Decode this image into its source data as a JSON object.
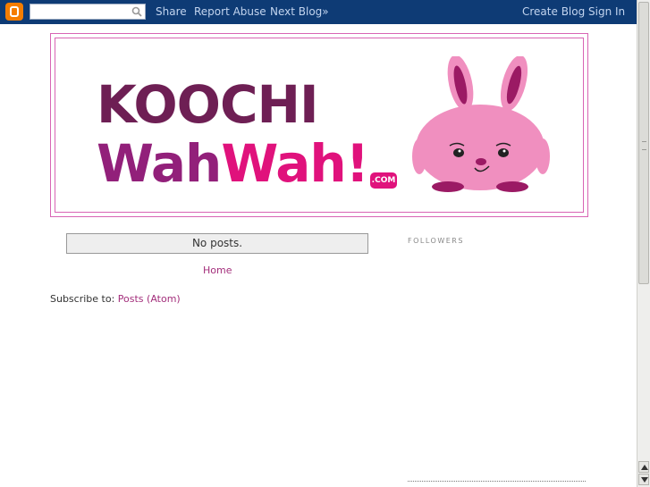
{
  "navbar": {
    "search_value": "",
    "links": {
      "share": "Share",
      "report_abuse": "Report Abuse",
      "next_blog": "Next Blog»",
      "create_blog": "Create Blog",
      "sign_in": "Sign In"
    }
  },
  "header": {
    "logo_line1": "KOOCHI",
    "logo_line2_part1": "Wah",
    "logo_line2_part2": "Wah!",
    "logo_com": ".COM"
  },
  "main": {
    "status_message": "No posts.",
    "home_link": "Home",
    "subscribe_label": "Subscribe to: ",
    "subscribe_link": "Posts (Atom)"
  },
  "sidebar": {
    "followers_title": "FOLLOWERS"
  },
  "colors": {
    "navbar_bg": "#0e3b75",
    "link_pink": "#a32e7b",
    "header_border": "#d864b4",
    "logo_dark": "#6e1f54",
    "logo_magenta": "#e0127c",
    "bunny_pink": "#f08fbf"
  }
}
